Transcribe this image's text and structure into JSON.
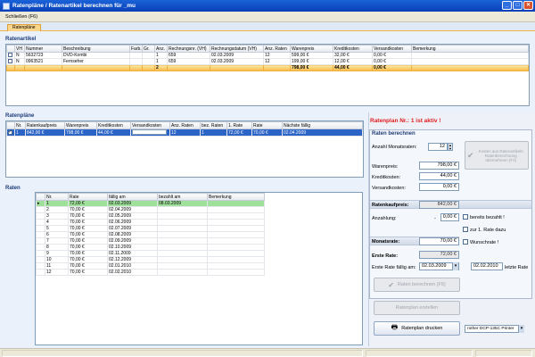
{
  "window": {
    "title": "Ratenpläne / Ratenartikel berechnen für _mu",
    "min": "_",
    "max": "□",
    "close": "✕"
  },
  "menu": {
    "close_label": "Schließen  (F6)"
  },
  "tab": {
    "label": "Ratenpläne"
  },
  "articles": {
    "title": "Ratenartikel",
    "headers": [
      "",
      "VH",
      "Nummer",
      "Beschreibung",
      "Farb.",
      "Gr.",
      "Anz.",
      "Rechnungsnr. (VH)",
      "Rechnungsdatum (VH)",
      "Anz. Raten",
      "Warenpreis",
      "Kreditkosten",
      "Versandkosten",
      "Bemerkung"
    ],
    "rows": [
      [
        "",
        "N",
        "5632723",
        "DVD-Kombi",
        "",
        "",
        "1",
        "659",
        "02.03.2009",
        "12",
        "599,00 €",
        "32,00 €",
        "0,00 €",
        ""
      ],
      [
        "",
        "N",
        "0963521",
        "Fernseher",
        "",
        "",
        "1",
        "659",
        "02.03.2009",
        "12",
        "199,00 €",
        "12,00 €",
        "0,00 €",
        ""
      ]
    ],
    "sum": [
      "",
      "",
      "",
      "",
      "",
      "",
      "2",
      "",
      "",
      "",
      "798,00 €",
      "44,00 €",
      "0,00 €",
      ""
    ]
  },
  "plans": {
    "title": "Ratenpläne",
    "headers": [
      "",
      "Nr.",
      "Ratenkaufpreis",
      "Warenpreis",
      "Kreditkosten",
      "Versandkosten",
      "Anz. Raten",
      "bez. Raten",
      "1. Rate",
      "Rate",
      "Nächste fällig"
    ],
    "rows": [
      [
        "",
        "1",
        "842,00 €",
        "798,00 €",
        "44,00 €",
        "0,00 €",
        "12",
        "1",
        "72,00 €",
        "70,00 €",
        "02.04.2009"
      ]
    ]
  },
  "rates": {
    "title": "Raten",
    "headers": [
      "",
      "Nr.",
      "Rate",
      "fällig am",
      "bezahlt am",
      "Bemerkung"
    ],
    "rows": [
      [
        "",
        "1",
        "72,00 €",
        "02.03.2009",
        "08.03.2009",
        ""
      ],
      [
        "",
        "2",
        "70,00 €",
        "02.04.2009",
        "",
        ""
      ],
      [
        "",
        "3",
        "70,00 €",
        "02.05.2009",
        "",
        ""
      ],
      [
        "",
        "4",
        "70,00 €",
        "02.06.2009",
        "",
        ""
      ],
      [
        "",
        "5",
        "70,00 €",
        "02.07.2009",
        "",
        ""
      ],
      [
        "",
        "6",
        "70,00 €",
        "02.08.2009",
        "",
        ""
      ],
      [
        "",
        "7",
        "70,00 €",
        "02.09.2009",
        "",
        ""
      ],
      [
        "",
        "8",
        "70,00 €",
        "02.10.2009",
        "",
        ""
      ],
      [
        "",
        "9",
        "70,00 €",
        "02.11.2009",
        "",
        ""
      ],
      [
        "",
        "10",
        "70,00 €",
        "02.12.2009",
        "",
        ""
      ],
      [
        "",
        "11",
        "70,00 €",
        "02.01.2010",
        "",
        ""
      ],
      [
        "",
        "12",
        "70,00 €",
        "02.02.2010",
        "",
        ""
      ]
    ]
  },
  "right": {
    "active": "Ratenplan Nr.: 1 ist aktiv !",
    "calc_title": "Raten berechnen",
    "num_months_label": "Anzahl Monatsraten:",
    "num_months_value": "12",
    "calc_hint": "Kosten aus Ratenartikeln Ratenberechnung übernehmen (F4)",
    "goods_label": "Warenpreis:",
    "goods_value": "798,00 €",
    "credit_label": "Kreditkosten:",
    "credit_value": "44,00 €",
    "shipping_label": "Versandkosten:",
    "shipping_value": "0,00 €",
    "total_label": "Ratenkaufpreis:",
    "total_value": "842,00 €",
    "down_label": "Anzahlung:",
    "down_minus": "-",
    "down_value": "0,00 €",
    "paid_label": "bereits bezahlt !",
    "first_add_label": "zur 1. Rate dazu",
    "wish_label": "Wunschrate !",
    "monthly_label": "Monatsrate:",
    "monthly_value": "70,00 €",
    "first_label": "Erste Rate:",
    "first_value": "72,00 €",
    "first_due_label": "Erste Rate fällig am:",
    "first_due_value": "02.03.2009",
    "last_value": "02.02.2010",
    "last_label": "letzte Rate",
    "calc_button": "Raten berechnen  (F5)",
    "create_button": "Ratenplan erstellen",
    "print_button": "Ratenplan drucken",
    "printer_value": "rother DCP-135C Printer"
  }
}
